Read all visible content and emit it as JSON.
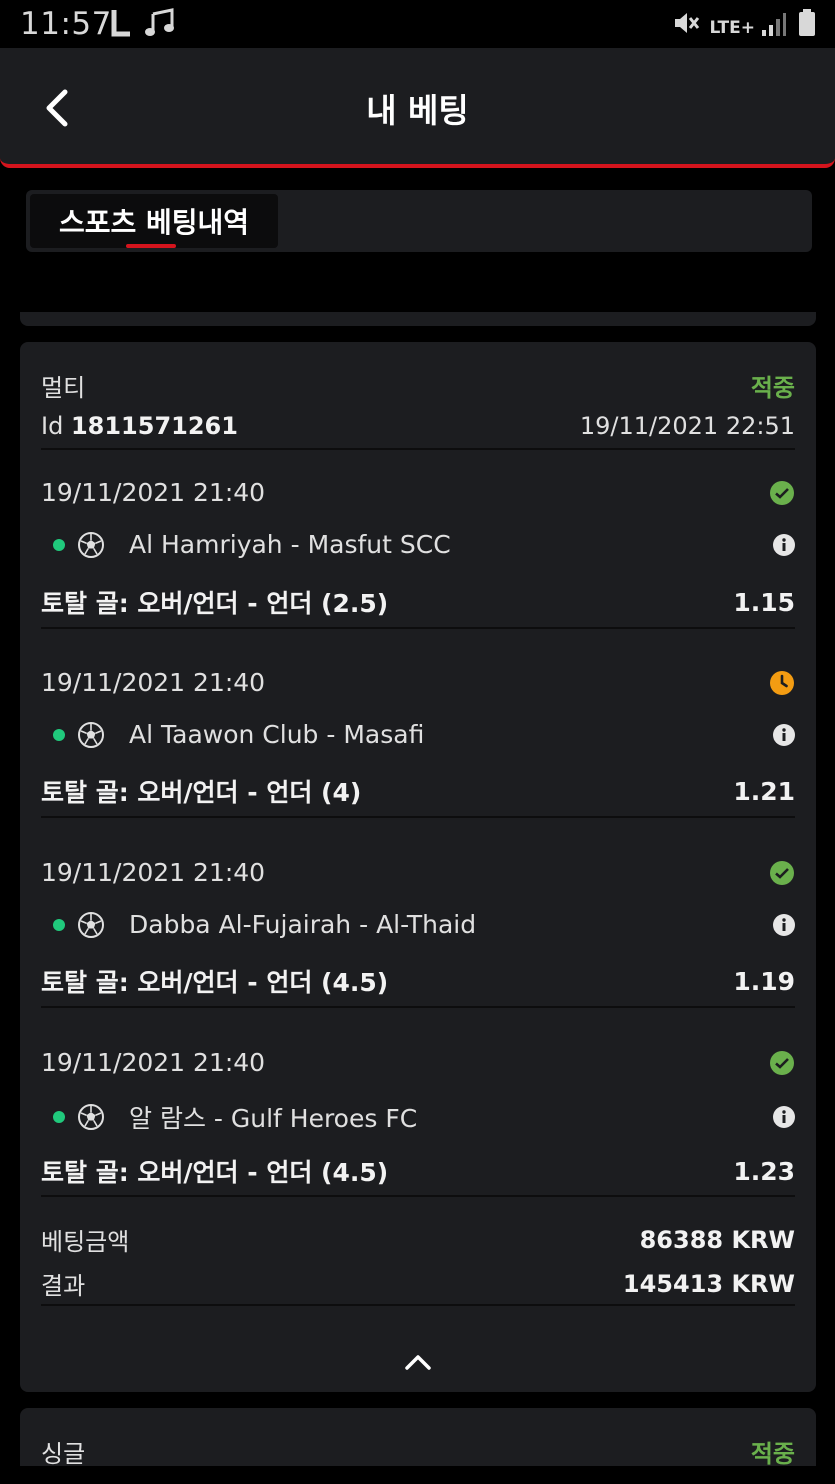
{
  "status_bar": {
    "time": "11:57",
    "icons": [
      "notification-l-icon",
      "music-note-icon",
      "mute-icon",
      "lte-signal-icon",
      "battery-icon"
    ],
    "lte": "LTE+"
  },
  "header": {
    "title": "내 베팅",
    "back_icon": "chevron-left-icon"
  },
  "tabs": [
    {
      "label": "스포츠 베팅내역",
      "active": true
    }
  ],
  "bet": {
    "type": "멀티",
    "status": "적중",
    "id_label": "Id",
    "id_value": "1811571261",
    "placed_at": "19/11/2021 22:51",
    "selections": [
      {
        "date": "19/11/2021 21:40",
        "status": "won",
        "match": "Al Hamriyah - Masfut SCC",
        "market": "토탈 골: 오버/언더 - 언더 (2.5)",
        "odds": "1.15"
      },
      {
        "date": "19/11/2021 21:40",
        "status": "pending",
        "match": "Al Taawon Club - Masafi",
        "market": "토탈 골: 오버/언더 - 언더 (4)",
        "odds": "1.21"
      },
      {
        "date": "19/11/2021 21:40",
        "status": "won",
        "match": "Dabba Al-Fujairah - Al-Thaid",
        "market": "토탈 골: 오버/언더 - 언더 (4.5)",
        "odds": "1.19"
      },
      {
        "date": "19/11/2021 21:40",
        "status": "won",
        "match": "알 람스 - Gulf Heroes FC",
        "market": "토탈 골: 오버/언더 - 언더 (4.5)",
        "odds": "1.23"
      }
    ],
    "stake_label": "베팅금액",
    "stake_value": "86388 KRW",
    "result_label": "결과",
    "result_value": "145413 KRW"
  },
  "next_bet": {
    "type": "싱글",
    "status": "적중"
  },
  "colors": {
    "accent_red": "#d4141d",
    "won_green": "#6ab04c",
    "pending_orange": "#f39c12",
    "live_dot": "#20c97c",
    "card_bg": "#1c1d20"
  }
}
